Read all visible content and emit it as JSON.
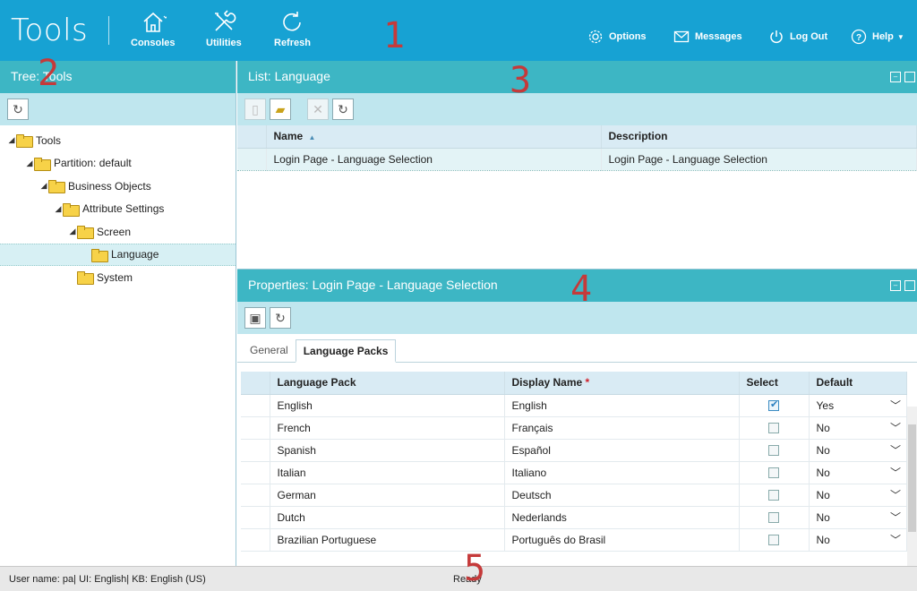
{
  "header": {
    "title": "Tools",
    "buttons": [
      {
        "label": "Consoles",
        "icon": "home-icon"
      },
      {
        "label": "Utilities",
        "icon": "tools-icon"
      },
      {
        "label": "Refresh",
        "icon": "refresh-icon"
      }
    ],
    "right_buttons": [
      {
        "label": "Options",
        "icon": "gear-icon"
      },
      {
        "label": "Messages",
        "icon": "envelope-icon"
      },
      {
        "label": "Log Out",
        "icon": "power-icon"
      },
      {
        "label": "Help",
        "icon": "help-icon"
      }
    ],
    "color": "#17a2d3"
  },
  "markers": [
    "1",
    "2",
    "3",
    "4",
    "5"
  ],
  "tree_panel": {
    "title": "Tree: Tools",
    "nodes": [
      {
        "label": "Tools",
        "level": 0,
        "expanded": true
      },
      {
        "label": "Partition: default",
        "level": 1,
        "expanded": true
      },
      {
        "label": "Business Objects",
        "level": 2,
        "expanded": true
      },
      {
        "label": "Attribute Settings",
        "level": 3,
        "expanded": true
      },
      {
        "label": "Screen",
        "level": 4,
        "expanded": true
      },
      {
        "label": "Language",
        "level": 5,
        "selected": true
      },
      {
        "label": "System",
        "level": 4
      }
    ]
  },
  "list_panel": {
    "title": "List: Language",
    "columns": [
      "Name",
      "Description"
    ],
    "sort_indicator": "▲",
    "rows": [
      {
        "name": "Login Page - Language Selection",
        "description": "Login Page - Language Selection"
      }
    ]
  },
  "properties_panel": {
    "title": "Properties: Login Page - Language Selection",
    "tabs": [
      "General",
      "Language Packs"
    ],
    "active_tab": "Language Packs",
    "columns": [
      "Language Pack",
      "Display Name",
      "Select",
      "Default"
    ],
    "required_marker": "*",
    "rows": [
      {
        "pack": "English",
        "display": "English",
        "select": true,
        "default": "Yes"
      },
      {
        "pack": "French",
        "display": "Français",
        "select": false,
        "default": "No"
      },
      {
        "pack": "Spanish",
        "display": "Español",
        "select": false,
        "default": "No"
      },
      {
        "pack": "Italian",
        "display": "Italiano",
        "select": false,
        "default": "No"
      },
      {
        "pack": "German",
        "display": "Deutsch",
        "select": false,
        "default": "No"
      },
      {
        "pack": "Dutch",
        "display": "Nederlands",
        "select": false,
        "default": "No"
      },
      {
        "pack": "Brazilian Portuguese",
        "display": "Português do Brasil",
        "select": false,
        "default": "No"
      }
    ]
  },
  "status": {
    "user": "User name: pa",
    "ui": "UI: English",
    "kb": "KB: English (US)",
    "state": "Ready"
  }
}
